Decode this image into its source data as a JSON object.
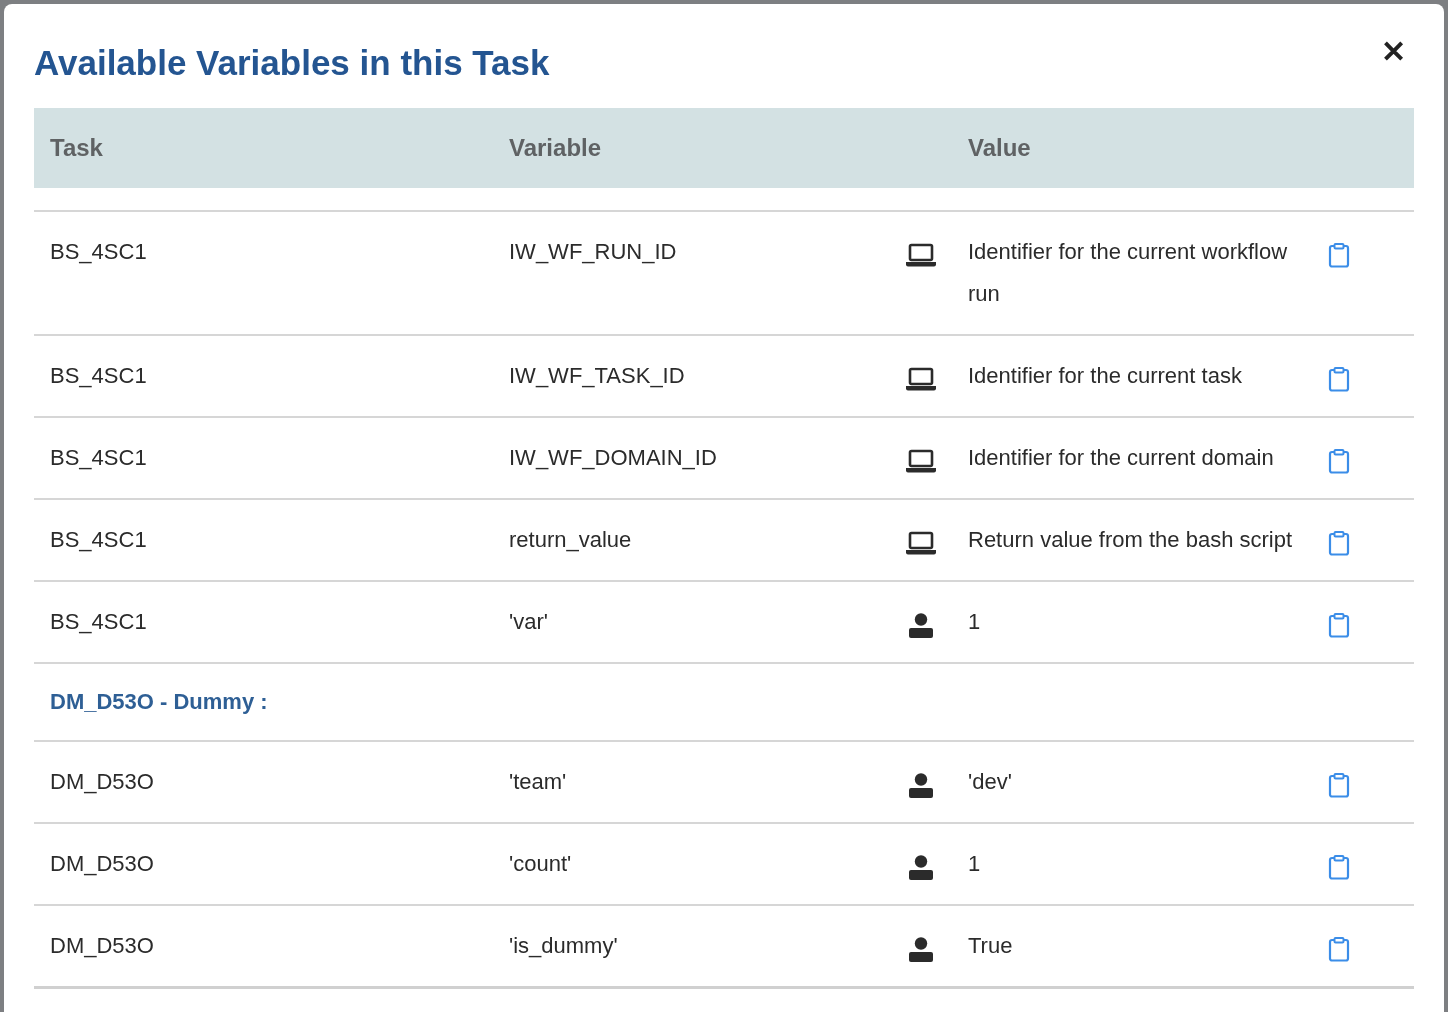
{
  "modal": {
    "title": "Available Variables in this Task",
    "close": "✕"
  },
  "table": {
    "columns": [
      "Task",
      "Variable",
      "Value"
    ],
    "rows": [
      {
        "kind": "system",
        "task": "BS_4SC1",
        "variable": "IW_WF_RUN_ID",
        "value": "Identifier for the current workflow run"
      },
      {
        "kind": "system",
        "task": "BS_4SC1",
        "variable": "IW_WF_TASK_ID",
        "value": "Identifier for the current task"
      },
      {
        "kind": "system",
        "task": "BS_4SC1",
        "variable": "IW_WF_DOMAIN_ID",
        "value": "Identifier for the current domain"
      },
      {
        "kind": "system",
        "task": "BS_4SC1",
        "variable": "return_value",
        "value": "Return value from the bash script"
      },
      {
        "kind": "user",
        "task": "BS_4SC1",
        "variable": "'var'",
        "value": "1"
      },
      {
        "kind": "group",
        "label": "DM_D53O - Dummy :"
      },
      {
        "kind": "user",
        "task": "DM_D53O",
        "variable": "'team'",
        "value": "'dev'"
      },
      {
        "kind": "user",
        "task": "DM_D53O",
        "variable": "'count'",
        "value": "1"
      },
      {
        "kind": "user",
        "task": "DM_D53O",
        "variable": "'is_dummy'",
        "value": "True"
      }
    ]
  }
}
